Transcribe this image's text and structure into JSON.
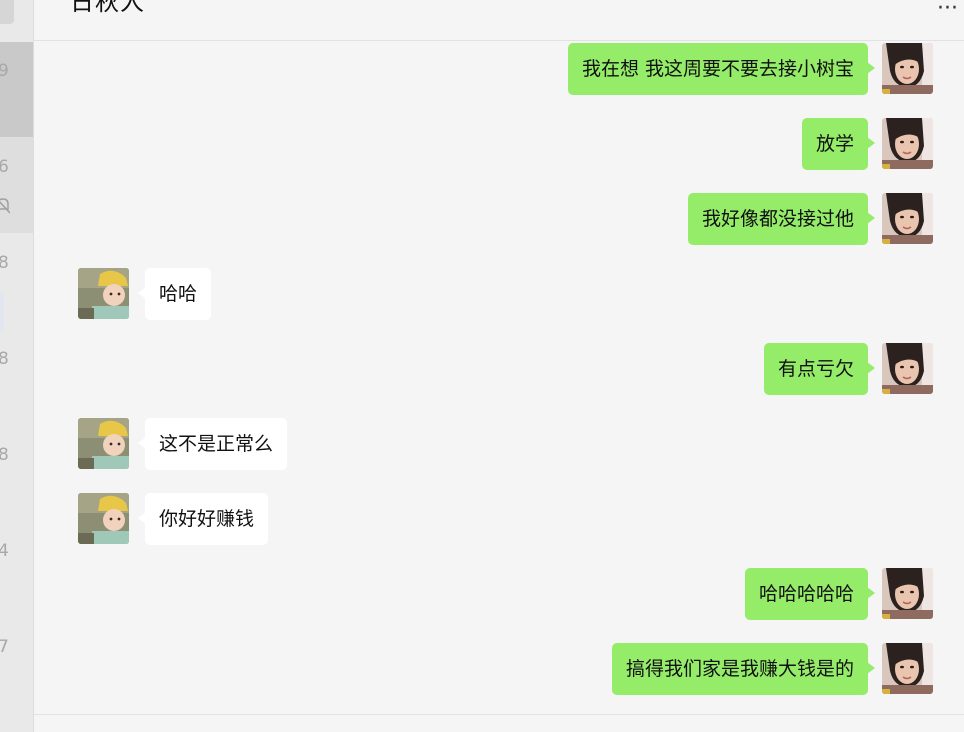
{
  "sidebar": {
    "numbers": [
      "9",
      "6",
      "8",
      "8",
      "8",
      "4",
      "7"
    ]
  },
  "header": {
    "title": "日秋人",
    "more_icon": "more-dots-icon",
    "more_label": "···"
  },
  "avatars": {
    "self": "woman-portrait-avatar",
    "other": "baby-yellow-hat-avatar"
  },
  "messages": [
    {
      "side": "right",
      "text": "我在想 我这周要不要去接小树宝"
    },
    {
      "side": "right",
      "text": "放学"
    },
    {
      "side": "right",
      "text": "我好像都没接过他"
    },
    {
      "side": "left",
      "text": "哈哈"
    },
    {
      "side": "right",
      "text": "有点亏欠"
    },
    {
      "side": "left",
      "text": "这不是正常么"
    },
    {
      "side": "left",
      "text": "你好好赚钱"
    },
    {
      "side": "right",
      "text": "哈哈哈哈哈"
    },
    {
      "side": "right",
      "text": "搞得我们家是我赚大钱是的"
    }
  ],
  "colors": {
    "self_bubble": "#95ec69",
    "other_bubble": "#ffffff",
    "background": "#f5f5f5"
  }
}
